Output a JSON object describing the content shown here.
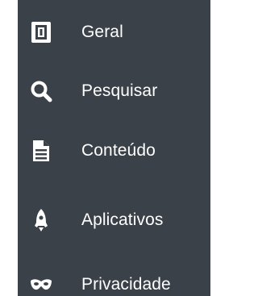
{
  "sidebar": {
    "items": [
      {
        "label": "Geral",
        "icon": "general-icon"
      },
      {
        "label": "Pesquisar",
        "icon": "search-icon"
      },
      {
        "label": "Conteúdo",
        "icon": "document-icon"
      },
      {
        "label": "Aplicativos",
        "icon": "rocket-icon"
      },
      {
        "label": "Privacidade",
        "icon": "mask-icon"
      }
    ]
  },
  "colors": {
    "sidebar_background": "#3a4149",
    "text": "#ffffff",
    "icon": "#ffffff"
  }
}
